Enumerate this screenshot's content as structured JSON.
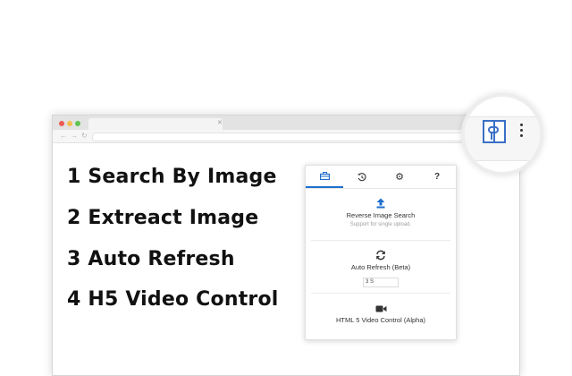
{
  "features": [
    {
      "label": "1 Search By Image"
    },
    {
      "label": "2 Extreact Image"
    },
    {
      "label": "3 Auto Refresh"
    },
    {
      "label": "4 H5 Video Control"
    }
  ],
  "popup": {
    "tabs": [
      {
        "icon": "toolbox-icon",
        "active": true
      },
      {
        "icon": "history-icon",
        "active": false
      },
      {
        "icon": "gear-icon",
        "active": false
      },
      {
        "icon": "help-icon",
        "label": "?",
        "active": false
      }
    ],
    "reverse_search": {
      "title": "Reverse Image Search",
      "subtitle": "Support for single upload."
    },
    "auto_refresh": {
      "title": "Auto Refresh (Beta)",
      "interval_value": "3 S"
    },
    "video": {
      "title": "HTML 5 Video Control (Alpha)"
    }
  },
  "colors": {
    "accent": "#1e6fce",
    "logo": "#3b70c6"
  }
}
